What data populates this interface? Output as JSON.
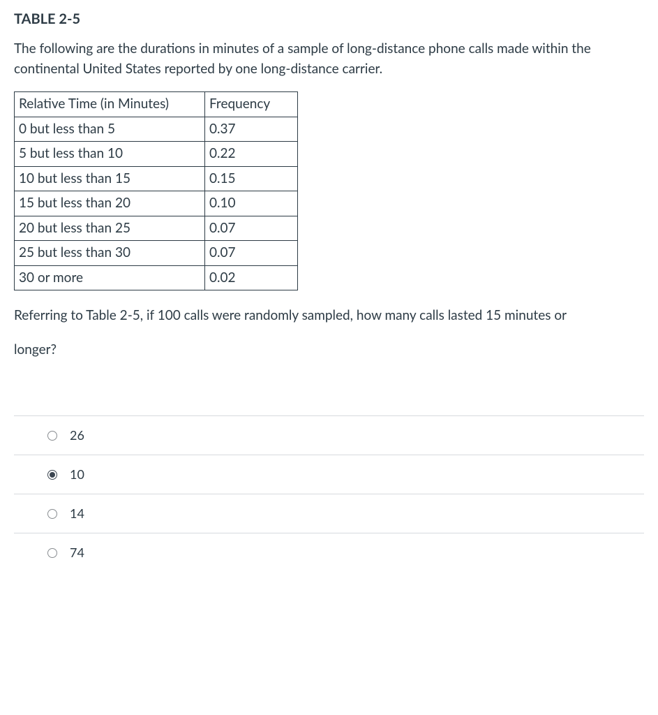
{
  "title": "TABLE 2-5",
  "intro": "The following are the durations in minutes of a sample of long-distance phone calls made within the continental United States reported by one long-distance carrier.",
  "table": {
    "header_time": "Relative Time (in Minutes)",
    "header_freq": "Frequency",
    "rows": [
      {
        "time": "0 but less than 5",
        "freq": "0.37"
      },
      {
        "time": "5 but less than 10",
        "freq": "0.22"
      },
      {
        "time": "10 but less than 15",
        "freq": "0.15"
      },
      {
        "time": "15 but less than 20",
        "freq": "0.10"
      },
      {
        "time": "20 but less than 25",
        "freq": "0.07"
      },
      {
        "time": "25 but less than 30",
        "freq": "0.07"
      },
      {
        "time": "30 or more",
        "freq": "0.02"
      }
    ]
  },
  "question_line1": "Referring to Table 2-5, if 100 calls were randomly sampled, how many calls lasted 15 minutes or",
  "question_line2": "longer?",
  "options": [
    {
      "label": "26",
      "selected": false
    },
    {
      "label": "10",
      "selected": true
    },
    {
      "label": "14",
      "selected": false
    },
    {
      "label": "74",
      "selected": false
    }
  ]
}
